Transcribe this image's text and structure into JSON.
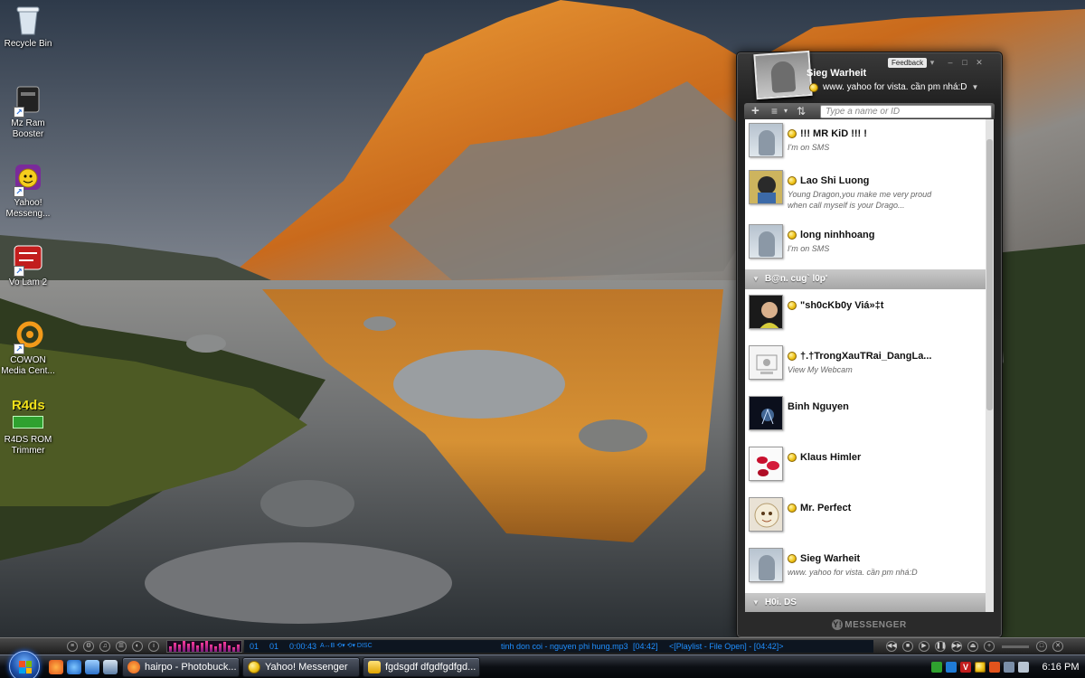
{
  "desktop": {
    "icons": [
      {
        "label": "Recycle Bin",
        "icon": "recycle-bin-icon"
      },
      {
        "label": "Mz Ram Booster",
        "icon": "ram-booster-icon"
      },
      {
        "label": "Yahoo! Messeng...",
        "icon": "yahoo-messenger-icon"
      },
      {
        "label": "Vo Lam 2",
        "icon": "vo-lam-icon"
      },
      {
        "label": "COWON Media Cent...",
        "icon": "cowon-icon"
      },
      {
        "label": "R4DS ROM Trimmer",
        "icon": "r4ds-icon",
        "badge": "R4ds"
      }
    ]
  },
  "messenger": {
    "feedback_label": "Feedback",
    "user_name": "Sieg Warheit",
    "status_message": "www. yahoo for vista. cần pm nhá:D",
    "search_placeholder": "Type a name or ID",
    "footer_brand": "MESSENGER",
    "footer_logo": "Y!",
    "groups": [
      {
        "name": "B@n. cug` l0p'"
      },
      {
        "name": "H0i. DS"
      }
    ],
    "contacts": [
      {
        "name": "!!! MR KiD !!! !",
        "message": "I'm on SMS",
        "status": "online"
      },
      {
        "name": "Lao Shi Luong",
        "message": "Young Dragon,you make me very proud when call myself is your Drago...",
        "status": "online"
      },
      {
        "name": "long ninhhoang",
        "message": "I'm on SMS",
        "status": "online"
      },
      {
        "name": "\"sh0cKb0y Viá»‡t",
        "message": "",
        "status": "online"
      },
      {
        "name": "†.†TrongXauTRai_DangLa...",
        "message": "View My Webcam",
        "status": "online"
      },
      {
        "name": "Binh Nguyen",
        "message": "",
        "status": "none"
      },
      {
        "name": "Klaus Himler",
        "message": "",
        "status": "online"
      },
      {
        "name": "Mr. Perfect",
        "message": "",
        "status": "online"
      },
      {
        "name": "Sieg Warheit",
        "message": "www. yahoo for vista. cần pm nhá:D",
        "status": "online"
      }
    ]
  },
  "player": {
    "track_num_a": "01",
    "track_num_b": "01",
    "elapsed": "0:00:43",
    "mode_flags": "A↔B  ⟲▾  ⟲▾  DISC",
    "now_playing": "tinh don coi  - nguyen phi hung.mp3",
    "duration": "[04:42]",
    "playlist_status": "<[Playlist - File Open] - [04:42]>"
  },
  "taskbar": {
    "tasks": [
      {
        "label": "hairpo - Photobuck...",
        "icon": "firefox-icon"
      },
      {
        "label": "Yahoo! Messenger",
        "icon": "yahoo-smiley-icon"
      },
      {
        "label": "fgdsgdf dfgdfgdfgd...",
        "icon": "chat-window-icon"
      }
    ],
    "clock": "6:16 PM"
  },
  "colors": {
    "accent_player_text": "#1f8fff",
    "yahoo_status": "#f0c419"
  }
}
